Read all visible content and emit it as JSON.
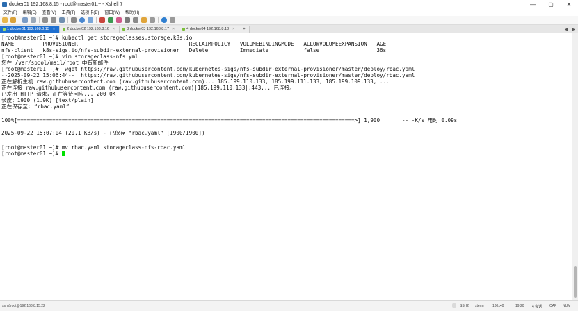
{
  "window": {
    "title": "docker01 192.168.8.15 - root@master01:~ - Xshell 7",
    "controls": {
      "minimize": "—",
      "maximize": "▢",
      "close": "✕"
    }
  },
  "menu": [
    "文件(F)",
    "编辑(E)",
    "查看(V)",
    "工具(T)",
    "选项卡(B)",
    "窗口(W)",
    "帮助(H)"
  ],
  "tabs": [
    {
      "label": "1 docker01 192.168.8.15",
      "active": true,
      "close": "×"
    },
    {
      "label": "2 docker02 192.168.8.16",
      "active": false,
      "close": "×"
    },
    {
      "label": "3 docker03 192.168.8.17",
      "active": false,
      "close": "×"
    },
    {
      "label": "4 docker04 192.168.8.18",
      "active": false,
      "close": "×"
    }
  ],
  "tab_add": "+",
  "tab_nav": {
    "prev": "◀",
    "next": "▶"
  },
  "terminal": {
    "lines": [
      "[root@master01 ~]# kubectl get storageclasses.storage.k8s.io",
      "NAME         PROVISIONER                                   RECLAIMPOLICY   VOLUMEBINDINGMODE   ALLOWVOLUMEEXPANSION   AGE",
      "nfs-client   k8s-sigs.io/nfs-subdir-external-provisioner   Delete          Immediate           false                  36s",
      "[root@master01 ~]# vim storageclass-nfs.yml",
      "您在 /var/spool/mail/root 中有新邮件",
      "[root@master01 ~]#  wget https://raw.githubusercontent.com/kubernetes-sigs/nfs-subdir-external-provisioner/master/deploy/rbac.yaml",
      "--2025-09-22 15:06:44--  https://raw.githubusercontent.com/kubernetes-sigs/nfs-subdir-external-provisioner/master/deploy/rbac.yaml",
      "正在解析主机 raw.githubusercontent.com (raw.githubusercontent.com)... 185.199.110.133, 185.199.111.133, 185.199.109.133, ...",
      "正在连接 raw.githubusercontent.com (raw.githubusercontent.com)|185.199.110.133|:443... 已连接。",
      "已发出 HTTP 请求，正在等待回应... 200 OK",
      "长度：1900 (1.9K) [text/plain]",
      "正在保存至: “rbac.yaml”",
      "",
      "100%[==========================================================================================================>] 1,900       --.-K/s 用时 0.09s",
      "",
      "2025-09-22 15:07:04 (20.1 KB/s) - 已保存 “rbac.yaml” [1900/1900])",
      "",
      "[root@master01 ~]# mv rbac.yaml storageclass-nfs-rbac.yaml",
      "[root@master01 ~]# "
    ]
  },
  "status": {
    "connection": "ssh://root@192.168.8.15:22",
    "protocol": "SSH2",
    "terminal_type": "xterm",
    "size": "180x40",
    "cursor_pos": "19,20",
    "sessions": "4 会话",
    "caps": "CAP",
    "num": "NUM"
  },
  "colors": {
    "active_tab": "#1e6fd0",
    "cursor": "#00e000"
  }
}
